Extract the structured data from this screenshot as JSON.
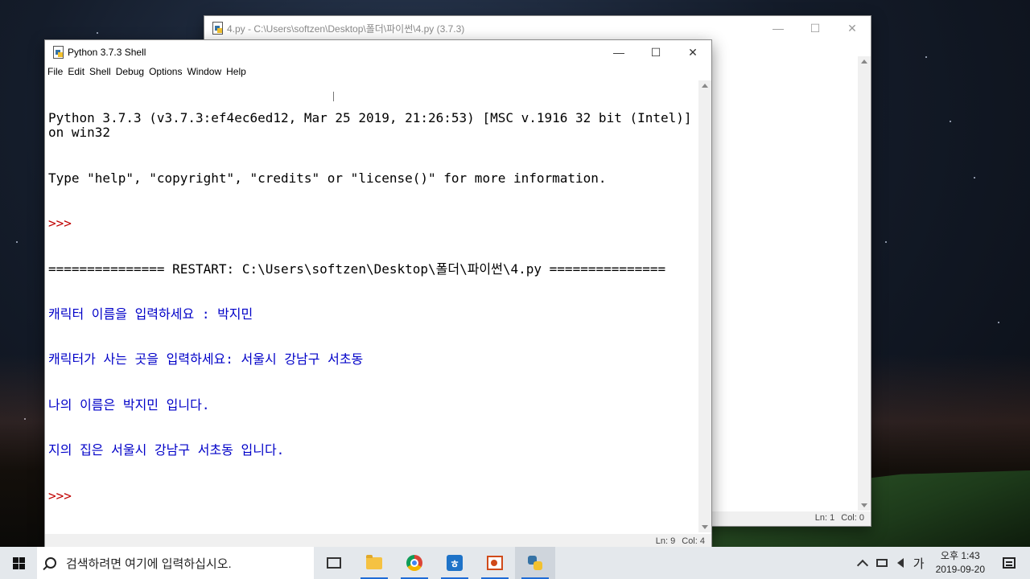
{
  "editor_window": {
    "title": "4.py - C:\\Users\\softzen\\Desktop\\폴더\\파이썬\\4.py (3.7.3)",
    "status_ln": "Ln: 1",
    "status_col": "Col: 0"
  },
  "shell_window": {
    "title": "Python 3.7.3 Shell",
    "menu": [
      "File",
      "Edit",
      "Shell",
      "Debug",
      "Options",
      "Window",
      "Help"
    ],
    "lines": [
      {
        "text": "Python 3.7.3 (v3.7.3:ef4ec6ed12, Mar 25 2019, 21:26:53) [MSC v.1916 32 bit (Intel)] on win32",
        "color": "black"
      },
      {
        "text": "Type \"help\", \"copyright\", \"credits\" or \"license()\" for more information.",
        "color": "black"
      },
      {
        "text": ">>> ",
        "color": "red"
      },
      {
        "text": "=============== RESTART: C:\\Users\\softzen\\Desktop\\폴더\\파이썬\\4.py ===============",
        "color": "black"
      },
      {
        "text": "캐릭터 이름을 입력하세요 : 박지민",
        "color": "blue"
      },
      {
        "text": "캐릭터가 사는 곳을 입력하세요: 서울시 강남구 서초동",
        "color": "blue"
      },
      {
        "text": "나의 이름은 박지민 입니다.",
        "color": "blue"
      },
      {
        "text": "지의 집은 서울시 강남구 서초동 입니다.",
        "color": "blue"
      },
      {
        "text": ">>> ",
        "color": "red"
      }
    ],
    "status_ln": "Ln: 9",
    "status_col": "Col: 4"
  },
  "window_controls": {
    "minimize": "—",
    "maximize": "☐",
    "close": "✕"
  },
  "taskbar": {
    "search_placeholder": "검색하려면 여기에 입력하십시오.",
    "apps": [
      "task-view",
      "file-explorer",
      "chrome",
      "hangul",
      "powerpoint",
      "python-idle"
    ],
    "ime": "가",
    "time": "오후 1:43",
    "date": "2019-09-20"
  },
  "colors": {
    "shell_output": "#0000c8",
    "prompt": "#c00000",
    "taskbar": "#e4e8ec"
  }
}
